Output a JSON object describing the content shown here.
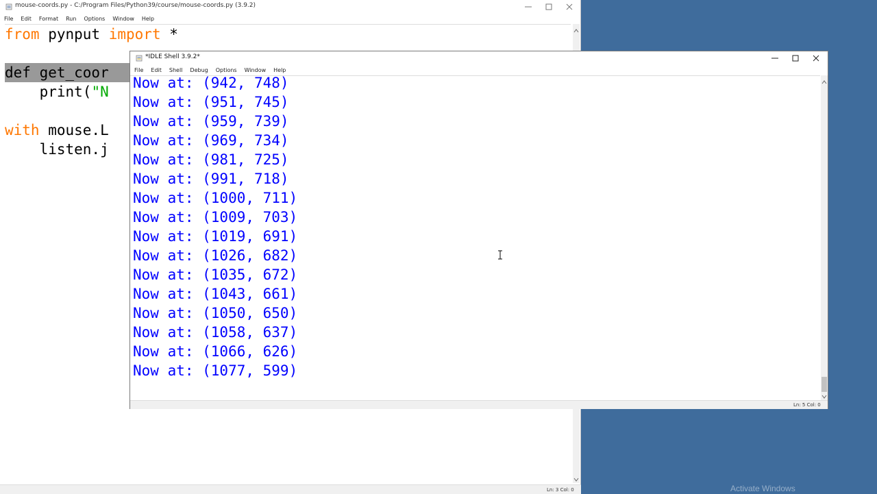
{
  "editor": {
    "title": "mouse-coords.py - C:/Program Files/Python39/course/mouse-coords.py (3.9.2)",
    "menu": [
      "File",
      "Edit",
      "Format",
      "Run",
      "Options",
      "Window",
      "Help"
    ],
    "lines": [
      {
        "kw1": "from",
        "t1": " pynput ",
        "kw2": "import",
        "t2": " *"
      },
      {
        "t": "def get_coor"
      },
      {
        "t": "    print(",
        "s": "\"N"
      },
      {
        "kw": "with",
        "t": " mouse.L"
      },
      {
        "t": "    listen.j"
      }
    ],
    "status": "Ln: 3  Col: 0"
  },
  "shell": {
    "title": "*IDLE Shell 3.9.2*",
    "menu": [
      "File",
      "Edit",
      "Shell",
      "Debug",
      "Options",
      "Window",
      "Help"
    ],
    "output": [
      "Now at: (942, 748)",
      "Now at: (951, 745)",
      "Now at: (959, 739)",
      "Now at: (969, 734)",
      "Now at: (981, 725)",
      "Now at: (991, 718)",
      "Now at: (1000, 711)",
      "Now at: (1009, 703)",
      "Now at: (1019, 691)",
      "Now at: (1026, 682)",
      "Now at: (1035, 672)",
      "Now at: (1043, 661)",
      "Now at: (1050, 650)",
      "Now at: (1058, 637)",
      "Now at: (1066, 626)",
      "Now at: (1077, 599)"
    ],
    "status": "Ln: 5  Col: 0"
  },
  "desktop": {
    "watermark": "Activate Windows"
  },
  "colors": {
    "desktop": "#3f6c9c",
    "keyword": "#ff7700",
    "string": "#00aa00",
    "output_text": "#0000ff",
    "selection": "#999999"
  },
  "icons": [
    "minimize-icon",
    "maximize-icon",
    "close-icon",
    "i-beam-cursor-icon"
  ]
}
